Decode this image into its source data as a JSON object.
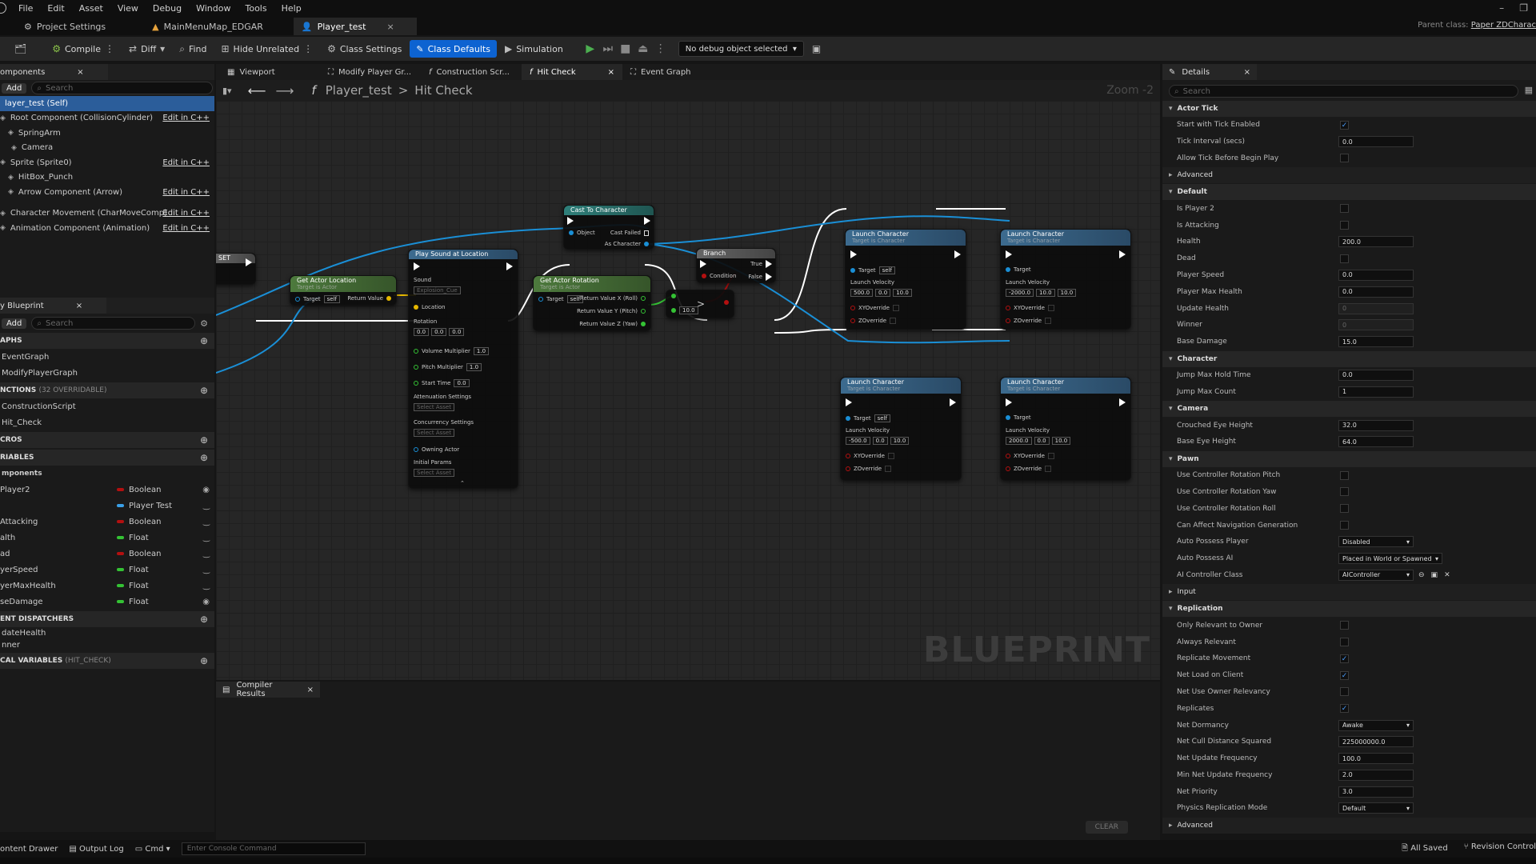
{
  "menu": [
    "File",
    "Edit",
    "Asset",
    "View",
    "Debug",
    "Window",
    "Tools",
    "Help"
  ],
  "doc_tabs": [
    {
      "label": "Project Settings"
    },
    {
      "label": "MainMenuMap_EDGAR"
    },
    {
      "label": "Player_test",
      "close": "×"
    }
  ],
  "parent_class": {
    "label": "Parent class:",
    "value": "Paper ZDCharac"
  },
  "toolbar": {
    "compile": "Compile",
    "diff": "Diff",
    "find": "Find",
    "hide_unrelated": "Hide Unrelated",
    "class_settings": "Class Settings",
    "class_defaults": "Class Defaults",
    "simulation": "Simulation",
    "debug_object": "No debug object selected"
  },
  "components_panel": {
    "title": "omponents",
    "add": "Add",
    "search_placeholder": "Search",
    "items": [
      {
        "label": "layer_test (Self)",
        "edit": ""
      },
      {
        "label": "Root Component (CollisionCylinder)",
        "edit": "Edit in C++"
      },
      {
        "label": "SpringArm",
        "edit": ""
      },
      {
        "label": "Camera",
        "edit": ""
      },
      {
        "label": "Sprite (Sprite0)",
        "edit": "Edit in C++"
      },
      {
        "label": "HitBox_Punch",
        "edit": ""
      },
      {
        "label": "Arrow Component (Arrow)",
        "edit": "Edit in C++"
      },
      {
        "label": "Character Movement (CharMoveComp)",
        "edit": "Edit in C++"
      },
      {
        "label": "Animation Component (Animation)",
        "edit": "Edit in C++"
      }
    ]
  },
  "my_blueprint": {
    "title": "y Blueprint",
    "add": "Add",
    "search_placeholder": "Search",
    "graphs_header": "APHS",
    "graphs": [
      "EventGraph",
      "ModifyPlayerGraph"
    ],
    "functions_header": "NCTIONS",
    "functions_count": "(32 OVERRIDABLE)",
    "functions": [
      "ConstructionScript",
      "Hit_Check"
    ],
    "macros_header": "CROS",
    "variables_header": "RIABLES",
    "components_sub": "mponents",
    "variables": [
      {
        "name": "Player2",
        "type": "Boolean",
        "color": "#b31010"
      },
      {
        "name": "",
        "type": "Player Test",
        "color": "#3aa0e8"
      },
      {
        "name": "Attacking",
        "type": "Boolean",
        "color": "#b31010"
      },
      {
        "name": "alth",
        "type": "Float",
        "color": "#34c234"
      },
      {
        "name": "ad",
        "type": "Boolean",
        "color": "#b31010"
      },
      {
        "name": "yerSpeed",
        "type": "Float",
        "color": "#34c234"
      },
      {
        "name": "yerMaxHealth",
        "type": "Float",
        "color": "#34c234"
      },
      {
        "name": "seDamage",
        "type": "Float",
        "color": "#34c234"
      }
    ],
    "dispatchers_header": "ENT DISPATCHERS",
    "dispatchers": [
      "dateHealth",
      "nner"
    ],
    "local_vars_header": "CAL VARIABLES",
    "local_vars_scope": "(HIT_CHECK)"
  },
  "graph_tabs": [
    "Viewport",
    "Modify Player Gr...",
    "Construction Scr...",
    "Hit Check",
    "Event Graph"
  ],
  "breadcrumb": {
    "root": "Player_test",
    "sep": ">",
    "current": "Hit Check"
  },
  "zoom": "Zoom -2",
  "watermark": "BLUEPRINT",
  "nodes": {
    "set_label": "SET",
    "get_actor_location": {
      "title": "Get Actor Location",
      "sub": "Target is Actor",
      "target": "Target",
      "target_val": "self",
      "ret": "Return Value"
    },
    "play_sound": {
      "title": "Play Sound at Location",
      "sound": "Sound",
      "sound_val": "Explosion_Cue",
      "location": "Location",
      "rotation": "Rotation",
      "rot_vals": [
        "0.0",
        "0.0",
        "0.0"
      ],
      "volume": "Volume Multiplier",
      "volume_val": "1.0",
      "pitch": "Pitch Multiplier",
      "pitch_val": "1.0",
      "start": "Start Time",
      "start_val": "0.0",
      "atten": "Attenuation Settings",
      "select": "Select Asset",
      "concur": "Concurrency Settings",
      "owning": "Owning Actor",
      "initial": "Initial Params"
    },
    "cast": {
      "title": "Cast To Character",
      "object": "Object",
      "failed": "Cast Failed",
      "as": "As Character"
    },
    "get_rot": {
      "title": "Get Actor Rotation",
      "sub": "Target is Actor",
      "target": "Target",
      "target_val": "self",
      "rx": "Return Value X (Roll)",
      "ry": "Return Value Y (Pitch)",
      "rz": "Return Value Z (Yaw)"
    },
    "compare": {
      "val": "10.0",
      "op": ">"
    },
    "branch": {
      "title": "Branch",
      "cond": "Condition",
      "t": "True",
      "f": "False"
    },
    "launch": [
      {
        "title": "Launch Character",
        "sub": "Target is Character",
        "target": "Target",
        "target_val": "self",
        "vel": "Launch Velocity",
        "x": "500.0",
        "y": "0.0",
        "z": "10.0",
        "xy": "XYOverride",
        "zo": "ZOverride"
      },
      {
        "title": "Launch Character",
        "sub": "Target is Character",
        "target": "Target",
        "target_val": "",
        "vel": "Launch Velocity",
        "x": "-2000.0",
        "y": "10.0",
        "z": "10.0",
        "xy": "XYOverride",
        "zo": "ZOverride"
      },
      {
        "title": "Launch Character",
        "sub": "Target is Character",
        "target": "Target",
        "target_val": "self",
        "vel": "Launch Velocity",
        "x": "-500.0",
        "y": "0.0",
        "z": "10.0",
        "xy": "XYOverride",
        "zo": "ZOverride"
      },
      {
        "title": "Launch Character",
        "sub": "Target is Character",
        "target": "Target",
        "target_val": "",
        "vel": "Launch Velocity",
        "x": "2000.0",
        "y": "0.0",
        "z": "10.0",
        "xy": "XYOverride",
        "zo": "ZOverride"
      }
    ]
  },
  "compiler_results": {
    "title": "Compiler Results",
    "clear": "CLEAR"
  },
  "details": {
    "title": "Details",
    "search_placeholder": "Search",
    "sections": [
      {
        "name": "Actor Tick",
        "rows": [
          {
            "label": "Start with Tick Enabled",
            "kind": "check",
            "value": true
          },
          {
            "label": "Tick Interval (secs)",
            "kind": "field",
            "value": "0.0"
          },
          {
            "label": "Allow Tick Before Begin Play",
            "kind": "check",
            "value": false
          }
        ]
      },
      {
        "name": "Advanced",
        "plain": true,
        "rows": []
      },
      {
        "name": "Default",
        "rows": [
          {
            "label": "Is Player 2",
            "kind": "check",
            "value": false
          },
          {
            "label": "Is Attacking",
            "kind": "check",
            "value": false
          },
          {
            "label": "Health",
            "kind": "field",
            "value": "200.0"
          },
          {
            "label": "Dead",
            "kind": "check",
            "value": false
          },
          {
            "label": "Player Speed",
            "kind": "field",
            "value": "0.0"
          },
          {
            "label": "Player Max Health",
            "kind": "field",
            "value": "0.0"
          },
          {
            "label": "Update Health",
            "kind": "dimfield",
            "value": "0"
          },
          {
            "label": "Winner",
            "kind": "dimfield",
            "value": "0"
          },
          {
            "label": "Base Damage",
            "kind": "field",
            "value": "15.0"
          }
        ]
      },
      {
        "name": "Character",
        "rows": [
          {
            "label": "Jump Max Hold Time",
            "kind": "field",
            "value": "0.0"
          },
          {
            "label": "Jump Max Count",
            "kind": "field",
            "value": "1"
          }
        ]
      },
      {
        "name": "Camera",
        "rows": [
          {
            "label": "Crouched Eye Height",
            "kind": "field",
            "value": "32.0"
          },
          {
            "label": "Base Eye Height",
            "kind": "field",
            "value": "64.0"
          }
        ]
      },
      {
        "name": "Pawn",
        "rows": [
          {
            "label": "Use Controller Rotation Pitch",
            "kind": "check",
            "value": false
          },
          {
            "label": "Use Controller Rotation Yaw",
            "kind": "check",
            "value": false
          },
          {
            "label": "Use Controller Rotation Roll",
            "kind": "check",
            "value": false
          },
          {
            "label": "Can Affect Navigation Generation",
            "kind": "check",
            "value": false
          },
          {
            "label": "Auto Possess Player",
            "kind": "dropdown",
            "value": "Disabled"
          },
          {
            "label": "Auto Possess AI",
            "kind": "dropdown-wide",
            "value": "Placed in World or Spawned"
          },
          {
            "label": "AI Controller Class",
            "kind": "dropdown",
            "value": "AIController"
          }
        ]
      },
      {
        "name": "Input",
        "plain": true,
        "rows": []
      },
      {
        "name": "Replication",
        "rows": [
          {
            "label": "Only Relevant to Owner",
            "kind": "check",
            "value": false
          },
          {
            "label": "Always Relevant",
            "kind": "check",
            "value": false
          },
          {
            "label": "Replicate Movement",
            "kind": "check",
            "value": true
          },
          {
            "label": "Net Load on Client",
            "kind": "check",
            "value": true
          },
          {
            "label": "Net Use Owner Relevancy",
            "kind": "check",
            "value": false
          },
          {
            "label": "Replicates",
            "kind": "check",
            "value": true
          },
          {
            "label": "Net Dormancy",
            "kind": "dropdown",
            "value": "Awake"
          },
          {
            "label": "Net Cull Distance Squared",
            "kind": "field",
            "value": "225000000.0"
          },
          {
            "label": "Net Update Frequency",
            "kind": "field",
            "value": "100.0"
          },
          {
            "label": "Min Net Update Frequency",
            "kind": "field",
            "value": "2.0"
          },
          {
            "label": "Net Priority",
            "kind": "field",
            "value": "3.0"
          },
          {
            "label": "Physics Replication Mode",
            "kind": "dropdown",
            "value": "Default"
          }
        ]
      },
      {
        "name": "Advanced",
        "plain": true,
        "rows": []
      }
    ]
  },
  "statusbar": {
    "content_drawer": "ontent Drawer",
    "output_log": "Output Log",
    "cmd": "Cmd",
    "console_placeholder": "Enter Console Command",
    "all_saved": "All Saved",
    "revision": "Revision Control"
  }
}
